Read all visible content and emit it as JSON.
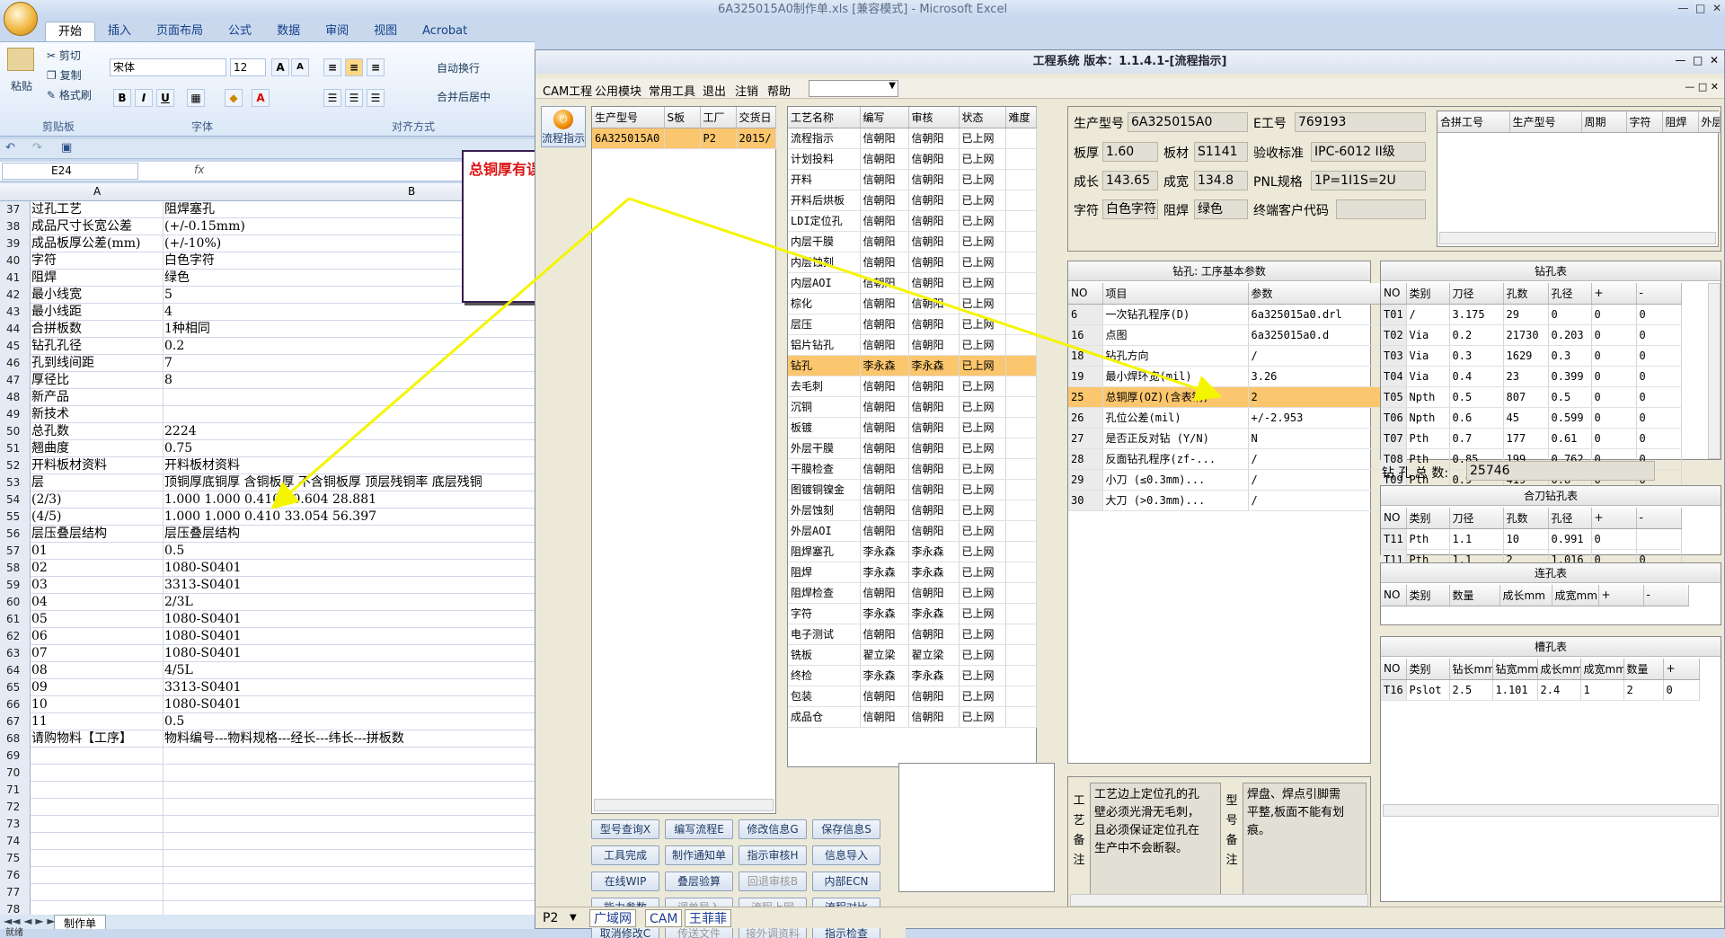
{
  "excel": {
    "window_title": "6A325015A0制作单.xls  [兼容模式] - Microsoft Excel",
    "tabs": [
      "开始",
      "插入",
      "页面布局",
      "公式",
      "数据",
      "审阅",
      "视图",
      "Acrobat"
    ],
    "clipboard": {
      "paste": "粘贴",
      "cut": "剪切",
      "copy": "复制",
      "format_painter": "格式刷",
      "group": "剪贴板"
    },
    "font": {
      "name": "宋体",
      "size": "12",
      "group": "字体",
      "bold": "B",
      "italic": "I",
      "underline": "U",
      "grow": "A",
      "shrink": "A"
    },
    "align": {
      "group": "对齐方式",
      "wrap": "自动换行",
      "merge": "合并后居中"
    },
    "name_box": "E24",
    "fx": "fx",
    "col_a": "A",
    "col_b": "B",
    "sheet_tab": "制作单",
    "status_text": "就绪",
    "rows": [
      {
        "n": "37",
        "a": "过孔工艺",
        "b": "阻焊塞孔"
      },
      {
        "n": "38",
        "a": "成品尺寸长宽公差",
        "b": "(+/-0.15mm)"
      },
      {
        "n": "39",
        "a": "成品板厚公差(mm)",
        "b": "(+/-10%)"
      },
      {
        "n": "40",
        "a": "字符",
        "b": "白色字符"
      },
      {
        "n": "41",
        "a": "阻焊",
        "b": "绿色"
      },
      {
        "n": "42",
        "a": "最小线宽",
        "b": "5"
      },
      {
        "n": "43",
        "a": "最小线距",
        "b": "4"
      },
      {
        "n": "44",
        "a": "合拼板数",
        "b": "1种相同"
      },
      {
        "n": "45",
        "a": "钻孔孔径",
        "b": "0.2"
      },
      {
        "n": "46",
        "a": "孔到线间距",
        "b": "7"
      },
      {
        "n": "47",
        "a": "厚径比",
        "b": "8"
      },
      {
        "n": "48",
        "a": "新产品",
        "b": ""
      },
      {
        "n": "49",
        "a": "新技术",
        "b": ""
      },
      {
        "n": "50",
        "a": "总孔数",
        "b": "2224"
      },
      {
        "n": "51",
        "a": "翘曲度",
        "b": "0.75"
      },
      {
        "n": "52",
        "a": "开料板材资料",
        "b": "开料板材资料"
      },
      {
        "n": "53",
        "a": "层",
        "b": "顶铜厚底铜厚  含铜板厚  不含铜板厚  顶层残铜率  底层残铜"
      },
      {
        "n": "54",
        "a": "(2/3)",
        "b": "1.000   1.000          0.410        60.604     28.881"
      },
      {
        "n": "55",
        "a": "(4/5)",
        "b": "1.000   1.000          0.410        33.054     56.397"
      },
      {
        "n": "56",
        "a": "层压叠层结构",
        "b": "层压叠层结构"
      },
      {
        "n": "57",
        "a": "01",
        "b": "0.5"
      },
      {
        "n": "58",
        "a": "02",
        "b": "1080-S0401"
      },
      {
        "n": "59",
        "a": "03",
        "b": "3313-S0401"
      },
      {
        "n": "60",
        "a": "04",
        "b": "2/3L"
      },
      {
        "n": "61",
        "a": "05",
        "b": "1080-S0401"
      },
      {
        "n": "62",
        "a": "06",
        "b": "1080-S0401"
      },
      {
        "n": "63",
        "a": "07",
        "b": "1080-S0401"
      },
      {
        "n": "64",
        "a": "08",
        "b": "4/5L"
      },
      {
        "n": "65",
        "a": "09",
        "b": "3313-S0401"
      },
      {
        "n": "66",
        "a": "10",
        "b": "1080-S0401"
      },
      {
        "n": "67",
        "a": "11",
        "b": "0.5"
      },
      {
        "n": "68",
        "a": "请购物料【工序】",
        "b": "物料编号---物料规格---经长---纬长---拼板数"
      },
      {
        "n": "69",
        "a": "",
        "b": ""
      },
      {
        "n": "70",
        "a": "",
        "b": ""
      },
      {
        "n": "71",
        "a": "",
        "b": ""
      },
      {
        "n": "72",
        "a": "",
        "b": ""
      },
      {
        "n": "73",
        "a": "",
        "b": ""
      },
      {
        "n": "74",
        "a": "",
        "b": ""
      },
      {
        "n": "75",
        "a": "",
        "b": ""
      },
      {
        "n": "76",
        "a": "",
        "b": ""
      },
      {
        "n": "77",
        "a": "",
        "b": ""
      },
      {
        "n": "78",
        "a": "",
        "b": ""
      }
    ]
  },
  "annotation": {
    "text": "总铜厚有误"
  },
  "app": {
    "title": "工程系统 版本：1.1.4.1-[流程指示]",
    "menu": [
      "CAM工程",
      "公用模块",
      "常用工具",
      "退出",
      "注销",
      "帮助"
    ],
    "flow_button": "流程指示",
    "orders": {
      "headers": [
        "生产型号",
        "S板",
        "工厂",
        "交货日"
      ],
      "rows": [
        [
          "6A325015A0",
          "",
          "P2",
          "2015/"
        ]
      ]
    },
    "process": {
      "headers": [
        "工艺名称",
        "编写",
        "审核",
        "状态",
        "难度"
      ],
      "rows": [
        [
          "流程指示",
          "信朝阳",
          "信朝阳",
          "已上网",
          ""
        ],
        [
          "计划投料",
          "信朝阳",
          "信朝阳",
          "已上网",
          ""
        ],
        [
          "开料",
          "信朝阳",
          "信朝阳",
          "已上网",
          ""
        ],
        [
          "开料后烘板",
          "信朝阳",
          "信朝阳",
          "已上网",
          ""
        ],
        [
          "LDI定位孔",
          "信朝阳",
          "信朝阳",
          "已上网",
          ""
        ],
        [
          "内层干膜",
          "信朝阳",
          "信朝阳",
          "已上网",
          ""
        ],
        [
          "内层蚀刻",
          "信朝阳",
          "信朝阳",
          "已上网",
          ""
        ],
        [
          "内层AOI",
          "信朝阳",
          "信朝阳",
          "已上网",
          ""
        ],
        [
          "棕化",
          "信朝阳",
          "信朝阳",
          "已上网",
          ""
        ],
        [
          "层压",
          "信朝阳",
          "信朝阳",
          "已上网",
          ""
        ],
        [
          "铝片钻孔",
          "信朝阳",
          "信朝阳",
          "已上网",
          ""
        ],
        [
          "钻孔",
          "李永森",
          "李永森",
          "已上网",
          ""
        ],
        [
          "去毛刺",
          "信朝阳",
          "信朝阳",
          "已上网",
          ""
        ],
        [
          "沉铜",
          "信朝阳",
          "信朝阳",
          "已上网",
          ""
        ],
        [
          "板镀",
          "信朝阳",
          "信朝阳",
          "已上网",
          ""
        ],
        [
          "外层干膜",
          "信朝阳",
          "信朝阳",
          "已上网",
          ""
        ],
        [
          "干膜检查",
          "信朝阳",
          "信朝阳",
          "已上网",
          ""
        ],
        [
          "图镀铜镍金",
          "信朝阳",
          "信朝阳",
          "已上网",
          ""
        ],
        [
          "外层蚀刻",
          "信朝阳",
          "信朝阳",
          "已上网",
          ""
        ],
        [
          "外层AOI",
          "信朝阳",
          "信朝阳",
          "已上网",
          ""
        ],
        [
          "阻焊塞孔",
          "李永森",
          "李永森",
          "已上网",
          ""
        ],
        [
          "阻焊",
          "李永森",
          "李永森",
          "已上网",
          ""
        ],
        [
          "阻焊检查",
          "信朝阳",
          "信朝阳",
          "已上网",
          ""
        ],
        [
          "字符",
          "李永森",
          "李永森",
          "已上网",
          ""
        ],
        [
          "电子测试",
          "信朝阳",
          "信朝阳",
          "已上网",
          ""
        ],
        [
          "铣板",
          "翟立梁",
          "翟立梁",
          "已上网",
          ""
        ],
        [
          "终检",
          "李永森",
          "李永森",
          "已上网",
          ""
        ],
        [
          "包装",
          "信朝阳",
          "信朝阳",
          "已上网",
          ""
        ],
        [
          "成品仓",
          "信朝阳",
          "信朝阳",
          "已上网",
          ""
        ]
      ]
    },
    "buttons": [
      [
        "型号查询X",
        "编写流程E",
        "修改信息G",
        "保存信息S"
      ],
      [
        "工具完成",
        "制作通知单",
        "指示审核H",
        "信息导入"
      ],
      [
        "在线WIP",
        "叠层验算",
        "回退审核B",
        "内部ECN"
      ],
      [
        "能力参数",
        "调单导入",
        "流程上网",
        "流程对比"
      ],
      [
        "取消修改C",
        "传送文件",
        "接外调资料",
        "指示检查"
      ]
    ],
    "info": {
      "model_label": "生产型号",
      "model": "6A325015A0",
      "eno_label": "E工号",
      "eno": "769193",
      "thick_label": "板厚",
      "thick": "1.60",
      "mat_label": "板材",
      "mat": "S1141",
      "std_label": "验收标准",
      "std": "IPC-6012 II级",
      "len_label": "成长",
      "len": "143.65",
      "wid_label": "成宽",
      "wid": "134.8",
      "pnl_label": "PNL规格",
      "pnl": "1P=1I1S=2U",
      "char_label": "字符",
      "char": "白色字符",
      "mask_label": "阻焊",
      "mask": "绿色",
      "cust_label": "终端客户代码",
      "cust": ""
    },
    "merge": {
      "headers": [
        "合拼工号",
        "生产型号",
        "周期",
        "字符",
        "阻焊",
        "外层"
      ]
    },
    "params": {
      "title": "钻孔: 工序基本参数",
      "headers": [
        "NO",
        "项目",
        "参数"
      ],
      "rows": [
        [
          "6",
          "一次钻孔程序(D)",
          "6a325015a0.drl"
        ],
        [
          "16",
          "点图",
          "6a325015a0.d"
        ],
        [
          "18",
          "钻孔方向",
          "/"
        ],
        [
          "19",
          "最小焊环宽(mil)",
          "3.26"
        ],
        [
          "25",
          "总铜厚(OZ)(含表铜)",
          "2"
        ],
        [
          "26",
          "孔位公差(mil)",
          "+/-2.953"
        ],
        [
          "27",
          "是否正反对钻 (Y/N)",
          "N"
        ],
        [
          "28",
          "反面钻孔程序(zf-...",
          "/"
        ],
        [
          "29",
          "小刀 (≤0.3mm)...",
          "/"
        ],
        [
          "30",
          "大刀 (>0.3mm)...",
          "/"
        ]
      ]
    },
    "drill": {
      "title": "钻孔表",
      "headers": [
        "NO",
        "类别",
        "刀径",
        "孔数",
        "孔径",
        "+",
        "-"
      ],
      "rows": [
        [
          "T01",
          "/",
          "3.175",
          "29",
          "0",
          "0",
          "0"
        ],
        [
          "T02",
          "Via",
          "0.2",
          "21730",
          "0.203",
          "0",
          "0"
        ],
        [
          "T03",
          "Via",
          "0.3",
          "1629",
          "0.3",
          "0",
          "0"
        ],
        [
          "T04",
          "Via",
          "0.4",
          "23",
          "0.399",
          "0",
          "0"
        ],
        [
          "T05",
          "Npth",
          "0.5",
          "807",
          "0.5",
          "0",
          "0"
        ],
        [
          "T06",
          "Npth",
          "0.6",
          "45",
          "0.599",
          "0",
          "0"
        ],
        [
          "T07",
          "Pth",
          "0.7",
          "177",
          "0.61",
          "0",
          "0"
        ],
        [
          "T08",
          "Pth",
          "0.85",
          "199",
          "0.762",
          "0",
          "0"
        ],
        [
          "T09",
          "Pth",
          "0.9",
          "419",
          "0.8",
          "0",
          "0"
        ]
      ],
      "total_label": "钻 孔 总 数:",
      "total": "25746"
    },
    "combo_drill": {
      "title": "合刀钻孔表",
      "headers": [
        "NO",
        "类别",
        "刀径",
        "孔数",
        "孔径",
        "+",
        "-"
      ],
      "rows": [
        [
          "T11",
          "Pth",
          "1.1",
          "10",
          "0.991",
          "0",
          ""
        ],
        [
          "T11",
          "Pth",
          "1.1",
          "2",
          "1.016",
          "0",
          "0"
        ]
      ]
    },
    "connect": {
      "title": "连孔表",
      "headers": [
        "NO",
        "类别",
        "数量",
        "成长mm",
        "成宽mm",
        "+",
        "-"
      ]
    },
    "slot": {
      "title": "槽孔表",
      "headers": [
        "NO",
        "类别",
        "钻长mm",
        "钻宽mm",
        "成长mm",
        "成宽mm",
        "数量",
        "+"
      ],
      "rows": [
        [
          "T16",
          "Pslot",
          "2.5",
          "1.101",
          "2.4",
          "1",
          "2",
          "0"
        ]
      ]
    },
    "memo1": {
      "label": "工艺备注",
      "text": "工艺边上定位孔的孔壁必须光滑无毛刺，且必须保证定位孔在生产中不会断裂。"
    },
    "memo2": {
      "label": "型号备注",
      "text": "焊盘、焊点引脚需平整,板面不能有划痕。"
    },
    "bottom_tabs": [
      "P2",
      "广域网",
      "CAM",
      "王菲菲"
    ]
  },
  "colors": {
    "accent": "#fbc66d",
    "annotation": "#dd1111",
    "arrow": "#f5f500"
  }
}
